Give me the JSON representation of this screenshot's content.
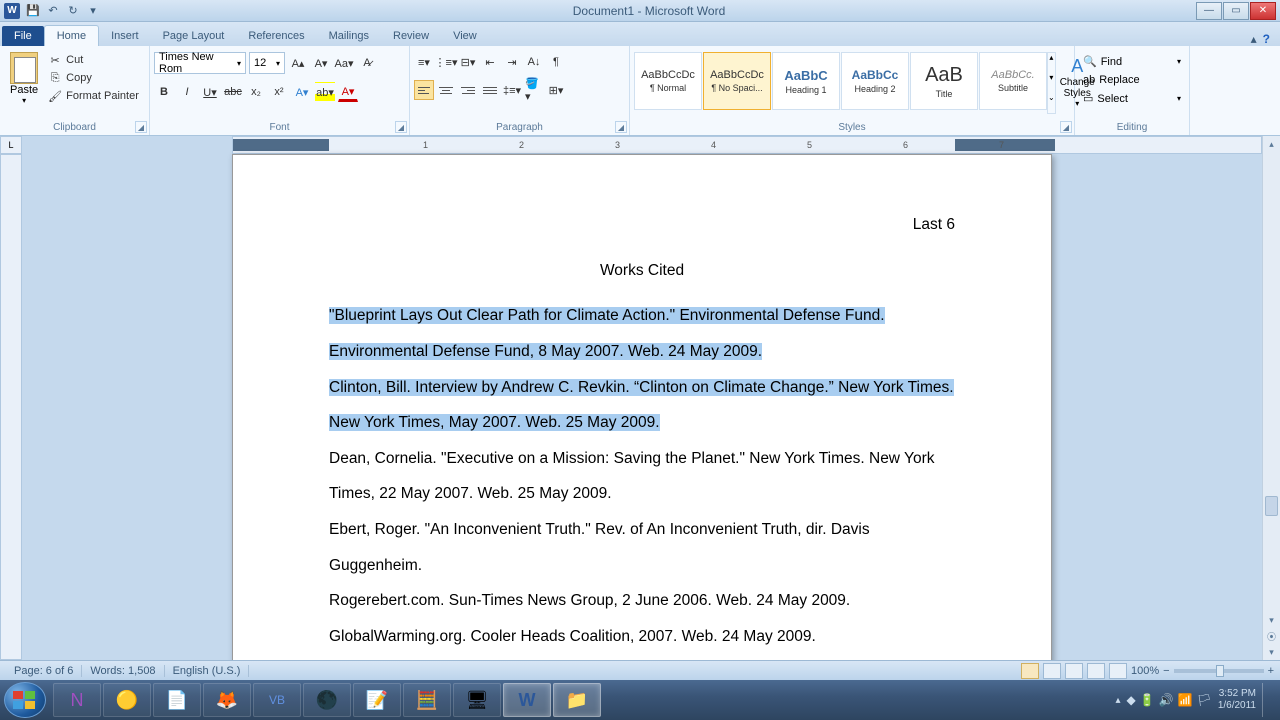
{
  "window": {
    "title": "Document1 - Microsoft Word"
  },
  "qat": {
    "save": "💾",
    "undo": "↶",
    "redo": "↻",
    "more": "▾"
  },
  "tabs": [
    "File",
    "Home",
    "Insert",
    "Page Layout",
    "References",
    "Mailings",
    "Review",
    "View"
  ],
  "active_tab": 1,
  "clipboard": {
    "paste": "Paste",
    "cut": "Cut",
    "copy": "Copy",
    "fmt": "Format Painter",
    "label": "Clipboard"
  },
  "font": {
    "name": "Times New Rom",
    "size": "12",
    "label": "Font"
  },
  "paragraph": {
    "label": "Paragraph"
  },
  "styles": {
    "label": "Styles",
    "items": [
      {
        "preview": "AaBbCcDc",
        "label": "¶ Normal",
        "cls": ""
      },
      {
        "preview": "AaBbCcDc",
        "label": "¶ No Spaci...",
        "cls": ""
      },
      {
        "preview": "AaBbC",
        "label": "Heading 1",
        "cls": "h1"
      },
      {
        "preview": "AaBbCc",
        "label": "Heading 2",
        "cls": "h2"
      },
      {
        "preview": "AaB",
        "label": "Title",
        "cls": "title"
      },
      {
        "preview": "AaBbCc.",
        "label": "Subtitle",
        "cls": "subtitle"
      }
    ],
    "active": 1,
    "change": "Change Styles"
  },
  "editing": {
    "find": "Find",
    "replace": "Replace",
    "select": "Select",
    "label": "Editing"
  },
  "document": {
    "header": "Last 6",
    "title": "Works Cited",
    "lines": [
      "\"Blueprint Lays Out Clear Path for Climate Action.\" Environmental Defense Fund.",
      "Environmental Defense Fund, 8 May 2007. Web. 24 May 2009.",
      "Clinton, Bill. Interview by Andrew C. Revkin. “Clinton on Climate Change.” New York Times.",
      "New York Times, May 2007. Web. 25 May 2009.",
      "Dean, Cornelia. \"Executive on a Mission: Saving the Planet.\" New York Times. New York",
      "Times, 22 May 2007. Web. 25 May 2009.",
      "Ebert, Roger. \"An Inconvenient Truth.\" Rev. of An Inconvenient Truth, dir. Davis Guggenheim.",
      "Rogerebert.com. Sun-Times News Group, 2 June 2006. Web. 24 May 2009.",
      "GlobalWarming.org. Cooler Heads Coalition, 2007. Web. 24 May 2009."
    ],
    "highlighted": [
      0,
      1,
      2,
      3
    ]
  },
  "ruler": [
    "1",
    "2",
    "3",
    "4",
    "5",
    "6",
    "7"
  ],
  "status": {
    "page": "Page: 6 of 6",
    "words": "Words: 1,508",
    "lang": "English (U.S.)",
    "zoom": "100%"
  },
  "clock": {
    "time": "3:52 PM",
    "date": "1/6/2011"
  }
}
